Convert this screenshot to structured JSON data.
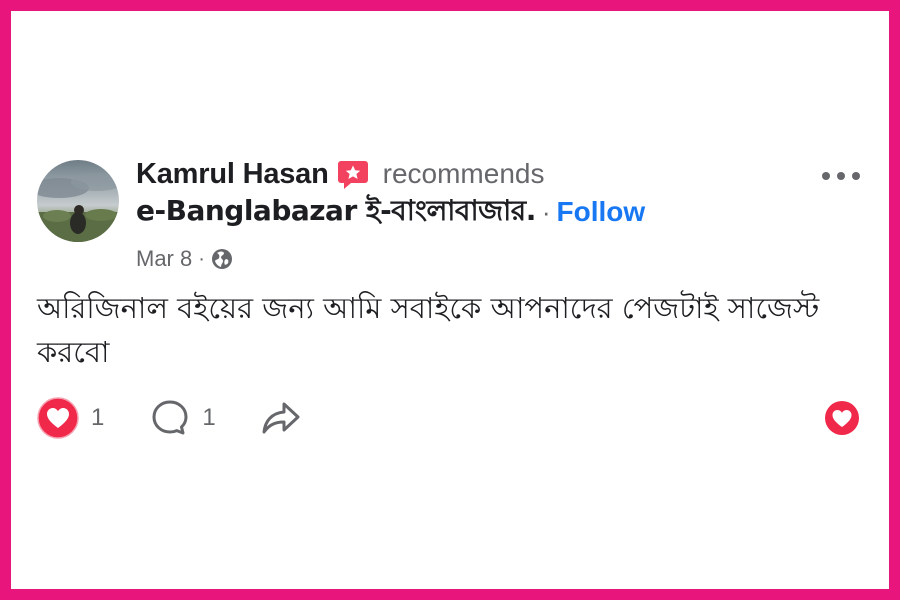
{
  "post": {
    "author_name": "Kamrul Hasan",
    "recommends_label": "recommends",
    "page_name": "e-Banglabazar ই-বাংলাবাজার.",
    "separator": "·",
    "follow_label": "Follow",
    "date": "Mar 8",
    "date_separator": "·",
    "visibility_icon": "globe-icon",
    "text": "অরিজিনাল বইয়ের জন্য আমি সবাইকে আপনাদের পেজটাই সাজেস্ট করবো"
  },
  "actions": {
    "love_count": "1",
    "comment_count": "1"
  },
  "colors": {
    "frame": "#e8157d",
    "accent": "#1877f2",
    "heart": "#f02849",
    "recommend_badge": "#f3425f",
    "secondary_text": "#65676b"
  }
}
